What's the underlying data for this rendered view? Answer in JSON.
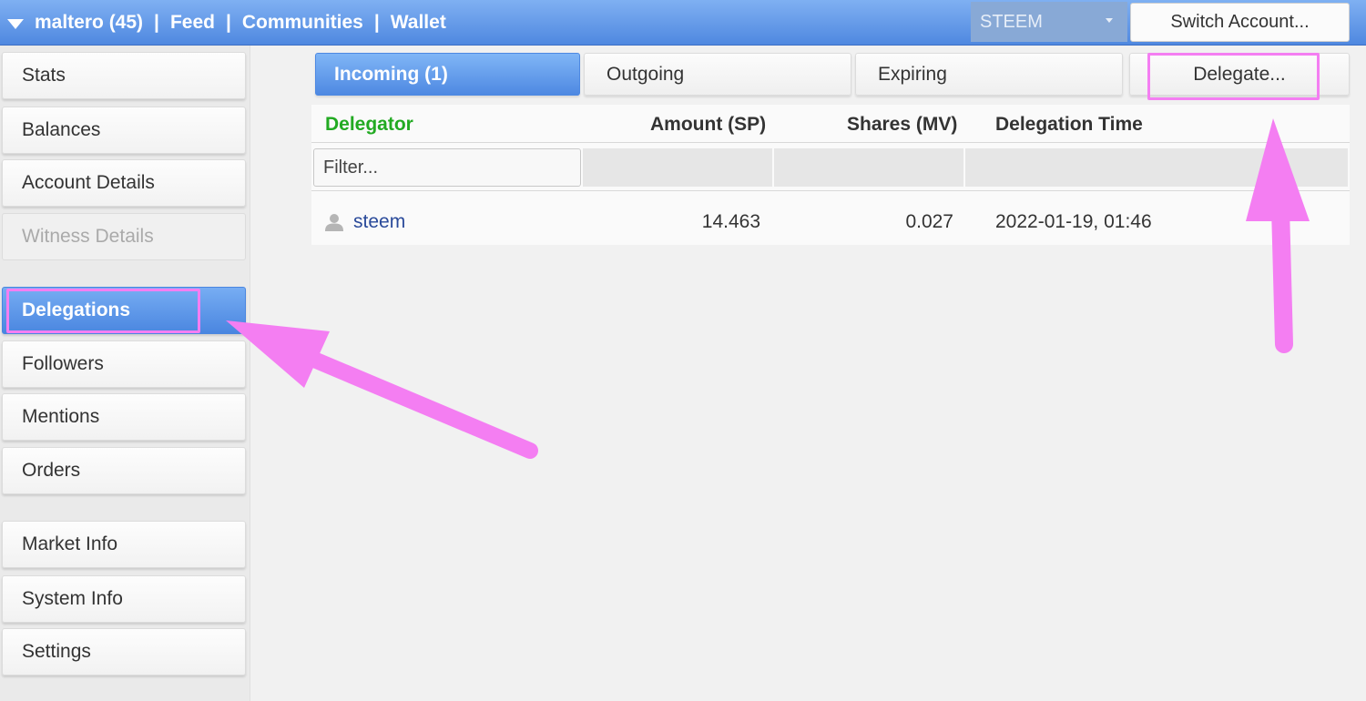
{
  "topbar": {
    "account": "maltero (45)",
    "nav": [
      "Feed",
      "Communities",
      "Wallet"
    ],
    "separator": "|",
    "coin": "STEEM",
    "switch_account": "Switch Account..."
  },
  "sidebar": {
    "items": [
      {
        "label": "Stats"
      },
      {
        "label": "Balances"
      },
      {
        "label": "Account Details"
      },
      {
        "label": "Witness Details"
      },
      {
        "label": "Delegations"
      },
      {
        "label": "Followers"
      },
      {
        "label": "Mentions"
      },
      {
        "label": "Orders"
      },
      {
        "label": "Market Info"
      },
      {
        "label": "System Info"
      },
      {
        "label": "Settings"
      }
    ],
    "active": "Delegations",
    "disabled": "Witness Details"
  },
  "tabs": {
    "incoming": "Incoming (1)",
    "outgoing": "Outgoing",
    "expiring": "Expiring",
    "delegate": "Delegate..."
  },
  "table": {
    "columns": [
      "Delegator",
      "Amount (SP)",
      "Shares (MV)",
      "Delegation Time"
    ],
    "sorted_column_color": "#22aa22",
    "filter_placeholder": "Filter...",
    "rows": [
      {
        "delegator": "steem",
        "amount": "14.463",
        "shares": "0.027",
        "time": "2022-01-19, 01:46"
      }
    ]
  },
  "colors": {
    "accent": "#4e89e2",
    "highlight": "#f47ef2"
  }
}
